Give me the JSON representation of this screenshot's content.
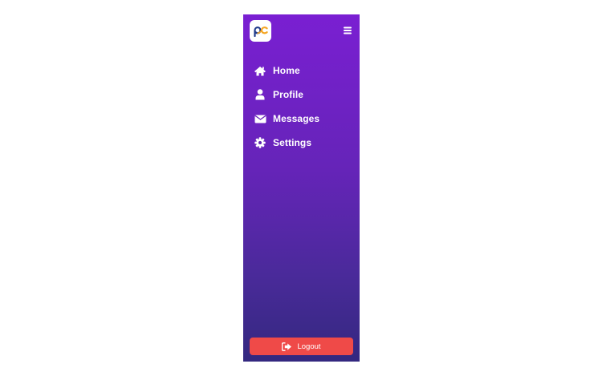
{
  "sidebar": {
    "logo": {
      "icon": "pc-logo-icon",
      "letters": "pc"
    },
    "menu_toggle_icon": "hamburger-icon",
    "items": [
      {
        "label": "Home",
        "icon": "home-icon"
      },
      {
        "label": "Profile",
        "icon": "user-icon"
      },
      {
        "label": "Messages",
        "icon": "envelope-icon"
      },
      {
        "label": "Settings",
        "icon": "gear-icon"
      }
    ],
    "logout": {
      "label": "Logout",
      "icon": "sign-out-icon"
    }
  },
  "colors": {
    "sidebar_gradient_top": "#7a1fd2",
    "sidebar_gradient_bottom": "#33287f",
    "logout_button": "#ef4a48",
    "text": "#ffffff"
  }
}
